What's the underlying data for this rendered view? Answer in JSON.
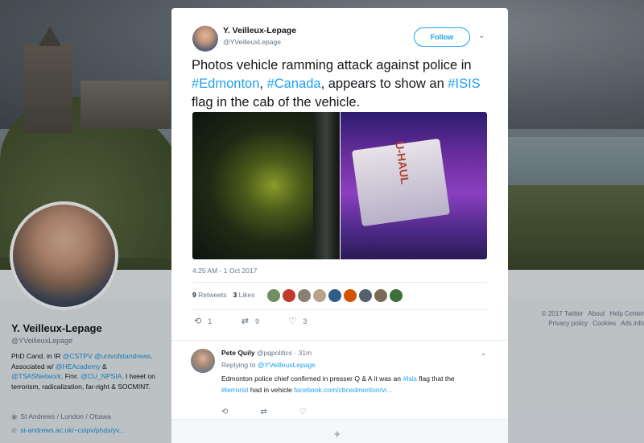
{
  "profile": {
    "name": "Y. Veilleux-Lepage",
    "handle": "@YVeilleuxLepage",
    "bio_parts": [
      "PhD Cand. in IR ",
      "@CSTPV",
      " ",
      "@univofstandrews",
      ". Associated w/ ",
      "@HEAcademy",
      " & ",
      "@TSASNetwork",
      ". Fmr. ",
      "@CU_NPSIA",
      ". I tweet on terrorism, radicalization, far-right & SOCMINT."
    ],
    "location": "St Andrews / London / Ottawa",
    "url": "st-andrews.ac.uk/~cstpv/phds/yv..."
  },
  "footer": {
    "copyright": "© 2017 Twitter",
    "links": [
      "About",
      "Help Center",
      "Privacy policy",
      "Cookies",
      "Ads info"
    ]
  },
  "tweet": {
    "author_name": "Y. Veilleux-Lepage",
    "author_handle": "@YVeilleuxLepage",
    "follow_label": "Follow",
    "text_parts": [
      "Photos vehicle ramming attack against police in ",
      "#Edmonton",
      ", ",
      "#Canada",
      ", appears to show an ",
      "#ISIS",
      " flag in the cab of the vehicle."
    ],
    "timestamp": "4:25 AM - 1 Oct 2017",
    "retweets_count": "9",
    "retweets_label": "Retweets",
    "likes_count": "3",
    "likes_label": "Likes",
    "actions": {
      "replies": "1",
      "retweets": "9",
      "likes": "3"
    },
    "photo_text": "U-HAUL"
  },
  "reply": {
    "author_name": "Pete Quily",
    "author_handle": "@pqpolitics",
    "time": "31m",
    "replying_prefix": "Replying to ",
    "replying_to": "@YVeilleuxLepage",
    "text_parts": [
      "Edmonton police chief confirmed in presser Q & A it was an ",
      "#Isis",
      " flag that the ",
      "#terrorist",
      " had in vehicle ",
      "facebook.com/cbcedmonton/vi..."
    ]
  },
  "colors": {
    "accent": "#1da1f2",
    "text": "#14171a",
    "muted": "#657786"
  }
}
